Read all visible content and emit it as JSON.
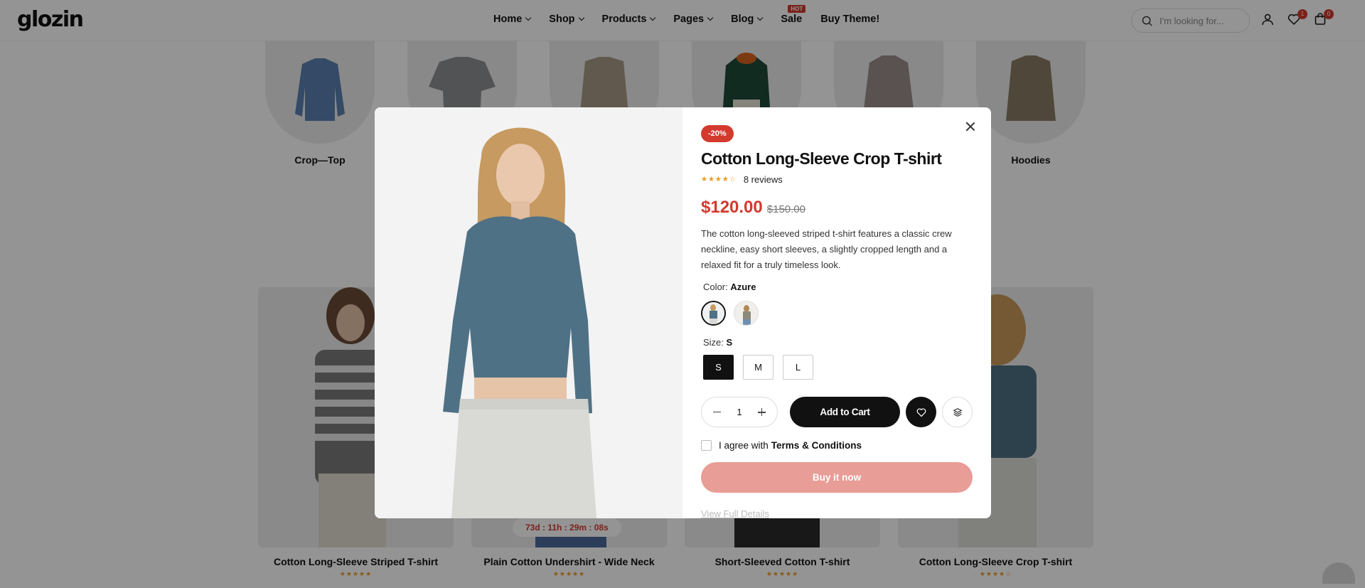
{
  "header": {
    "logo": "glozin",
    "nav": [
      "Home",
      "Shop",
      "Products",
      "Pages",
      "Blog",
      "Sale",
      "Buy Theme!"
    ],
    "hot_badge": "HOT",
    "search_placeholder": "I'm looking for...",
    "wishlist_count": "1",
    "cart_count": "0"
  },
  "categories": [
    {
      "label": "Crop—Top"
    },
    {
      "label": ""
    },
    {
      "label": ""
    },
    {
      "label": ""
    },
    {
      "label": ""
    },
    {
      "label": "Hoodies"
    }
  ],
  "products": [
    {
      "title": "Cotton Long-Sleeve Striped T-shirt",
      "stars": "★★★★★"
    },
    {
      "title": "Plain Cotton Undershirt - Wide Neck",
      "stars": "★★★★★",
      "timer": "73d : 11h : 29m : 08s"
    },
    {
      "title": "Short-Sleeved Cotton T-shirt",
      "stars": "★★★★★"
    },
    {
      "title": "Cotton Long-Sleeve Crop T-shirt",
      "stars": "★★★★☆"
    }
  ],
  "modal": {
    "discount": "-20%",
    "title": "Cotton Long-Sleeve Crop T-shirt",
    "stars": "★★★★☆",
    "reviews": "8 reviews",
    "price": "$120.00",
    "old_price": "$150.00",
    "description": "The cotton long-sleeved striped t-shirt features a classic crew neckline, easy short sleeves, a slightly cropped length and a relaxed fit for a truly timeless look.",
    "color_label": "Color:",
    "color_value": "Azure",
    "size_label": "Size:",
    "size_value": "S",
    "sizes": [
      "S",
      "M",
      "L"
    ],
    "quantity": "1",
    "add_to_cart": "Add to Cart",
    "agree_text": "I agree with",
    "terms": "Terms & Conditions",
    "buy_now": "Buy it now",
    "view_details": "View Full Details"
  },
  "colors": {
    "accent": "#d23a2d",
    "buy_now": "#e89d96",
    "dark": "#111111",
    "star": "#e89a1e",
    "shirt_azure": "#4f7185"
  }
}
